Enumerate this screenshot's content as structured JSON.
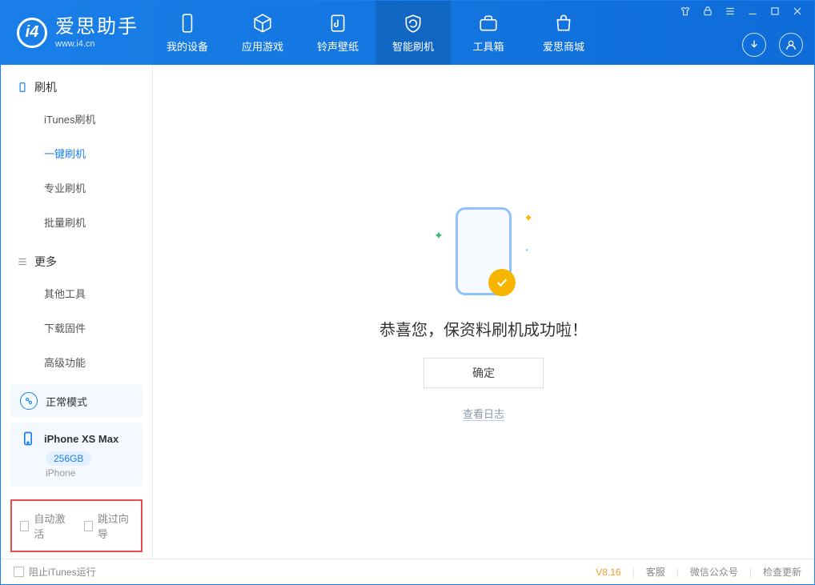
{
  "app": {
    "name": "爱思助手",
    "url": "www.i4.cn"
  },
  "nav": {
    "items": [
      {
        "label": "我的设备"
      },
      {
        "label": "应用游戏"
      },
      {
        "label": "铃声壁纸"
      },
      {
        "label": "智能刷机"
      },
      {
        "label": "工具箱"
      },
      {
        "label": "爱思商城"
      }
    ]
  },
  "sidebar": {
    "section_flash": "刷机",
    "items_flash": [
      {
        "label": "iTunes刷机"
      },
      {
        "label": "一键刷机"
      },
      {
        "label": "专业刷机"
      },
      {
        "label": "批量刷机"
      }
    ],
    "section_more": "更多",
    "items_more": [
      {
        "label": "其他工具"
      },
      {
        "label": "下载固件"
      },
      {
        "label": "高级功能"
      }
    ],
    "mode_card": "正常模式",
    "device": {
      "name": "iPhone XS Max",
      "capacity": "256GB",
      "type": "iPhone"
    },
    "opts": {
      "auto_activate": "自动激活",
      "skip_guide": "跳过向导"
    }
  },
  "main": {
    "success_msg": "恭喜您，保资料刷机成功啦！",
    "ok_btn": "确定",
    "log_link": "查看日志"
  },
  "footer": {
    "block_itunes": "阻止iTunes运行",
    "version": "V8.16",
    "links": {
      "service": "客服",
      "wechat": "微信公众号",
      "update": "检查更新"
    }
  }
}
